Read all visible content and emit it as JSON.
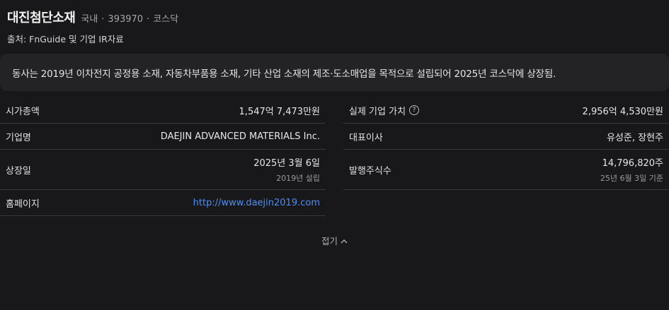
{
  "header": {
    "company_name": "대진첨단소재",
    "market": "국내",
    "code": "393970",
    "exchange": "코스닥",
    "source": "출처: FnGuide 및 기업 IR자료"
  },
  "description": "동사는 2019년 이차전지 공정용 소재, 자동차부품용 소재, 기타 산업 소재의 제조·도소매업을 목적으로 설립되어 2025년 코스닥에 상장됨.",
  "left_rows": {
    "market_cap": {
      "label": "시가총액",
      "value": "1,547억 7,473만원"
    },
    "company_name": {
      "label": "기업명",
      "value": "DAEJIN ADVANCED MATERIALS Inc."
    },
    "listing_date": {
      "label": "상장일",
      "value": "2025년 3월 6일",
      "sub": "2019년 설립"
    },
    "homepage": {
      "label": "홈페이지",
      "value": "http://www.daejin2019.com"
    }
  },
  "right_rows": {
    "enterprise_value": {
      "label": "실제 기업 가치",
      "value": "2,956억 4,530만원"
    },
    "ceo": {
      "label": "대표이사",
      "value": "유성준, 장현주"
    },
    "shares": {
      "label": "발행주식수",
      "value": "14,796,820주",
      "sub": "25년 6월 3일 기준"
    }
  },
  "collapse_label": "접기",
  "icons": {
    "help": "question-circle-icon",
    "collapse": "chevron-up-icon"
  },
  "colors": {
    "background": "#18181b",
    "card": "#232326",
    "link": "#4a8ff5"
  }
}
